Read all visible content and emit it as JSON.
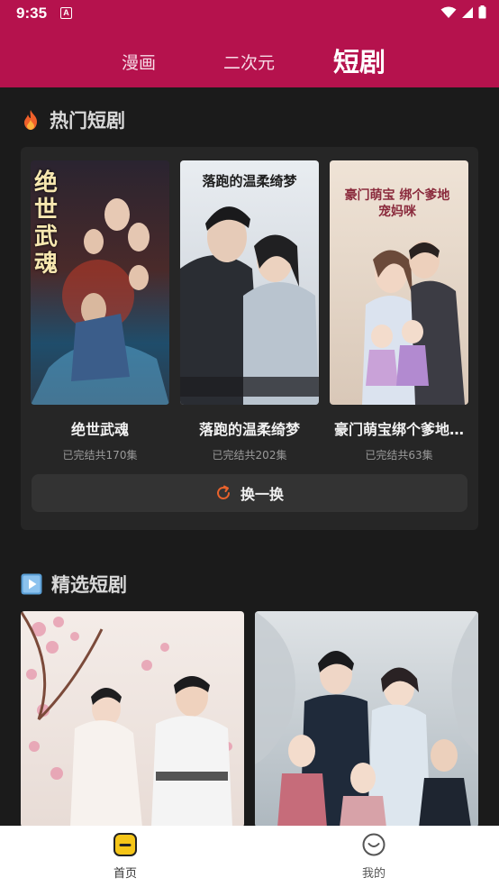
{
  "status_bar": {
    "time": "9:35",
    "notification_glyph": "A"
  },
  "top_tabs": [
    {
      "label": "漫画",
      "active": false
    },
    {
      "label": "二次元",
      "active": false
    },
    {
      "label": "短剧",
      "active": true
    }
  ],
  "hot_section": {
    "title": "热门短剧",
    "icon": "fire-icon",
    "dramas": [
      {
        "name": "绝世武魂",
        "status": "已完结共170集",
        "poster_text": "绝世武魂"
      },
      {
        "name": "落跑的温柔绮梦",
        "status": "已完结共202集",
        "poster_text": "落跑的温柔绮梦"
      },
      {
        "name": "豪门萌宝绑个爹地…",
        "status": "已完结共63集",
        "poster_text": "豪门萌宝 绑个爹地宠妈咪"
      }
    ],
    "refresh_label": "换一换"
  },
  "featured_section": {
    "title": "精选短剧",
    "icon": "play-icon"
  },
  "bottom_nav": [
    {
      "label": "首页",
      "icon": "home-icon",
      "active": true
    },
    {
      "label": "我的",
      "icon": "smile-icon",
      "active": false
    }
  ],
  "colors": {
    "brand": "#b5124d",
    "background": "#1b1b1b",
    "panel": "#262626",
    "accent_orange": "#e8622c",
    "nav_active": "#f5c518"
  }
}
